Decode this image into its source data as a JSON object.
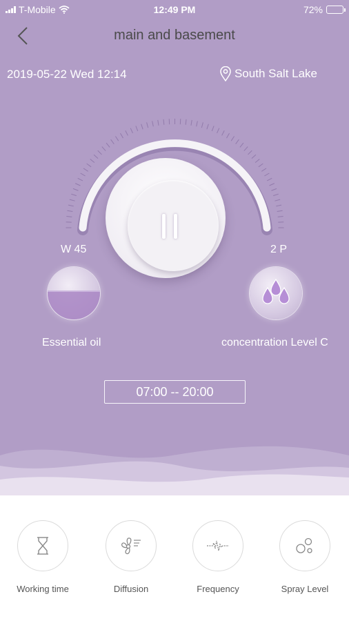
{
  "status_bar": {
    "carrier": "T-Mobile",
    "time": "12:49 PM",
    "battery_percent": "72%",
    "battery_level": 0.72
  },
  "header": {
    "back_icon": "chevron-left-icon",
    "title": "main and basement"
  },
  "info": {
    "datetime": "2019-05-22 Wed 12:14",
    "location_icon": "location-pin-icon",
    "location": "South Salt Lake"
  },
  "dial": {
    "state_icon": "pause-icon",
    "left_value": "W 45",
    "right_value": "2 P",
    "oil_level": 0.55
  },
  "indicators": {
    "oil_label": "Essential oil",
    "concentration_label": "concentration Level C"
  },
  "schedule": {
    "range": "07:00 -- 20:00"
  },
  "bottom_nav": [
    {
      "label": "Working time",
      "icon": "hourglass-icon"
    },
    {
      "label": "Diffusion",
      "icon": "fan-icon"
    },
    {
      "label": "Frequency",
      "icon": "pulse-wave-icon"
    },
    {
      "label": "Spray Level",
      "icon": "bubbles-icon"
    }
  ],
  "colors": {
    "background": "#b19dc6",
    "oil_fill": "#a885c4",
    "text_dark": "#4a4a4a",
    "white": "#ffffff"
  }
}
